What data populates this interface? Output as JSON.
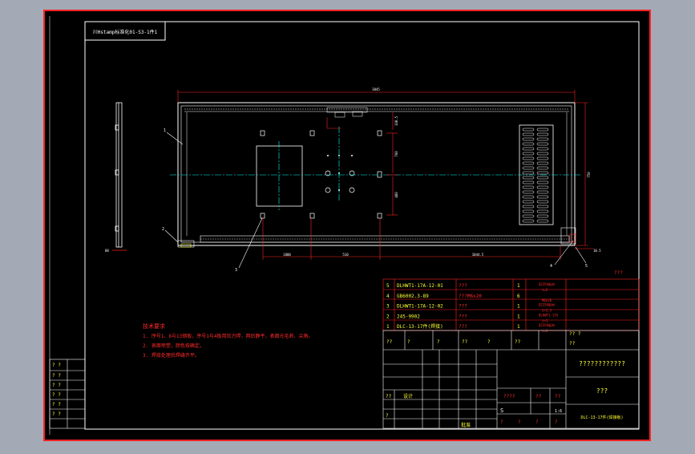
{
  "top_stamp": "川Hstamp标准化01-S3-1件1",
  "dims": {
    "overall_width": "3045",
    "seg_a": "1800",
    "seg_b": "510",
    "seg_c": "1044.5",
    "right_small": "10.5",
    "height": "750",
    "v1": "108.5",
    "v2": "700",
    "v3": "480",
    "left_small": "88"
  },
  "leaders": [
    "1",
    "2",
    "3",
    "4",
    "5"
  ],
  "notes": {
    "title": "技术要求",
    "lines": [
      "1. 序号1、6与13钢板，序号1与4板用压力焊，两后静平，表面光毛刺、尖角。",
      "2. 表面喷塑，颜色按确定。",
      "3. 焊接处理后焊缝齐平。"
    ]
  },
  "bom": {
    "rows": [
      {
        "no": "5",
        "code": "DLHWT1-17A-12-01",
        "name": "???",
        "qty": "1",
        "tag": "Q235A板材",
        "sub": "t=2"
      },
      {
        "no": "4",
        "code": "GB6002.3-89",
        "name": "???M6x20",
        "qty": "6",
        "tag": "",
        "sub": "M6x20"
      },
      {
        "no": "3",
        "code": "DLHWT1-17A-12-02",
        "name": "???",
        "qty": "1",
        "tag": "Q235A板材",
        "sub": "t=1.5"
      },
      {
        "no": "2",
        "code": "245-9902",
        "name": "???",
        "qty": "1",
        "tag": "DLHWT1-17A",
        "sub": "t=1"
      },
      {
        "no": "1",
        "code": "DLC-13-17件(焊接)",
        "name": "???",
        "qty": "1",
        "tag": "Q235A板材",
        "sub": "t=2"
      }
    ],
    "header": [
      "??",
      "?",
      "?",
      "??",
      "?",
      "??",
      "?? ?",
      "??"
    ]
  },
  "title_block": {
    "corner": "???",
    "company": "????????????",
    "part_name": "???",
    "drawing_no": "DLC-13-17件(焊接板)",
    "scale": "1:6",
    "stamp_a": "????",
    "stamp_b": "??",
    "stamp_c": "??",
    "design": "设计",
    "approve": "批准",
    "sheet_s": "S",
    "sheet_q": [
      "?",
      "?",
      "?",
      "?"
    ],
    "side_labels": [
      "??",
      "?",
      "?"
    ],
    "rows_left": [
      "??",
      "?"
    ]
  },
  "left_strip": [
    "? ?",
    "? ?",
    "? ?",
    "? ?",
    "? ?",
    "? ?"
  ],
  "colors": {
    "background": "#000000",
    "outer_gray": "#a3aab6",
    "frame": "#ffffff",
    "cad_red": "#ff2a2a",
    "cad_green": "#00ff55",
    "cad_yellow": "#ffff33",
    "cad_cyan": "#00ffff",
    "cad_magenta": "#ff33ff"
  }
}
